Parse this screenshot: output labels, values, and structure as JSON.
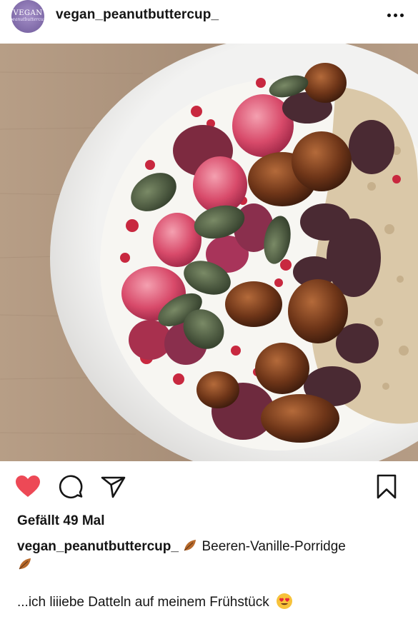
{
  "post": {
    "avatar": {
      "line1": "VEGAN",
      "line2": "peanutbuttercup"
    },
    "username": "vegan_peanutbuttercup_",
    "more_icon": "more-horizontal-icon",
    "photo_alt": "Porridge bowl with raspberries, dates, pumpkin seeds and granola",
    "likes_label": "Gefällt 49 Mal",
    "caption": {
      "username": "vegan_peanutbuttercup_",
      "leaf_icon": "autumn-leaf-emoji",
      "text": "Beeren-Vanille-Porridge"
    },
    "second_line": {
      "text": "...ich liiiebe Datteln auf meinem Frühstück",
      "emoji": "heart-eyes-emoji"
    }
  },
  "actions": {
    "like_icon": "heart-filled-icon",
    "comment_icon": "comment-icon",
    "share_icon": "send-icon",
    "save_icon": "bookmark-icon"
  },
  "colors": {
    "like_red": "#ed4956",
    "text": "#151515",
    "background": "#ffffff"
  }
}
